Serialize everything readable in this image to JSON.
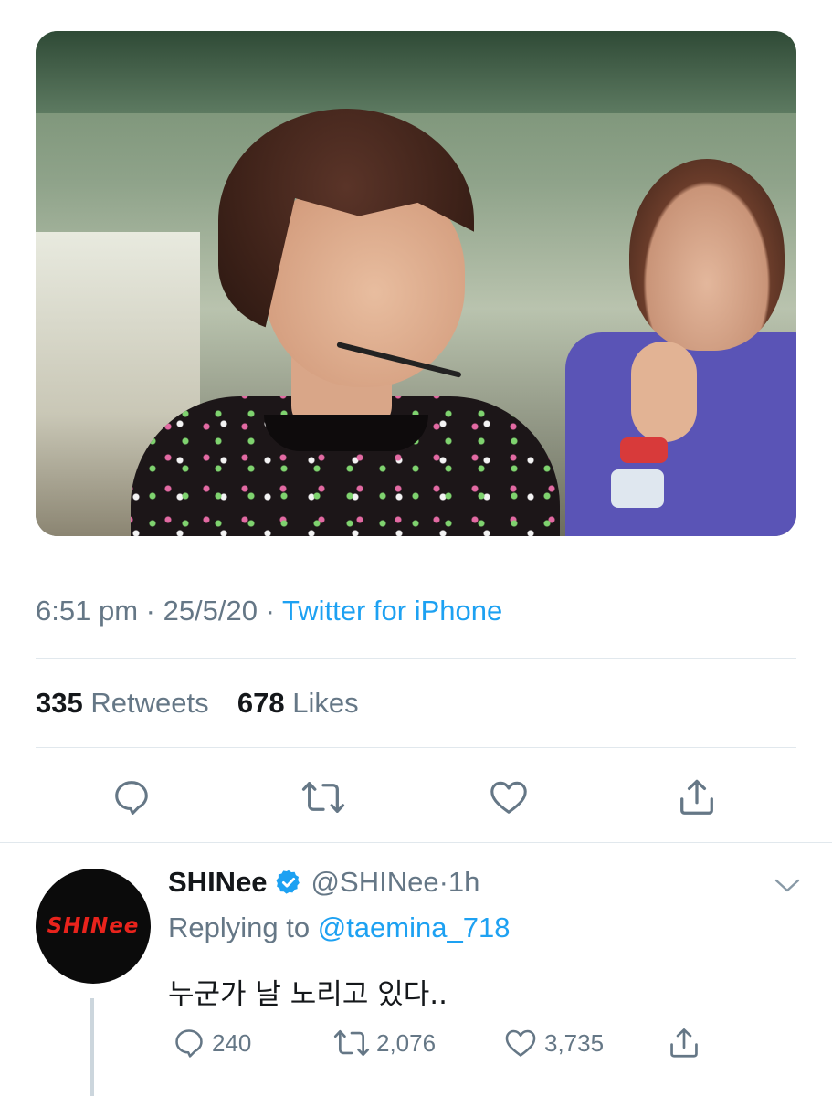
{
  "tweet": {
    "time": "6:51 pm",
    "date": "25/5/20",
    "source": "Twitter for iPhone",
    "retweets_count": "335",
    "retweets_label": "Retweets",
    "likes_count": "678",
    "likes_label": "Likes",
    "actions": {
      "reply_icon": "reply-icon",
      "retweet_icon": "retweet-icon",
      "like_icon": "heart-icon",
      "share_icon": "share-icon"
    }
  },
  "reply": {
    "display_name": "SHINee",
    "handle": "@SHINee",
    "time": "1h",
    "replying_prefix": "Replying to",
    "replying_to": "@taemina_718",
    "text": "누군가 날 노리고 있다..",
    "avatar_logo": "SHINee",
    "reply_count": "240",
    "retweet_count": "2,076",
    "like_count": "3,735"
  },
  "colors": {
    "link": "#1da1f2",
    "secondary": "#657786",
    "divider": "#e1e8ed",
    "logo_red": "#e8231c"
  }
}
